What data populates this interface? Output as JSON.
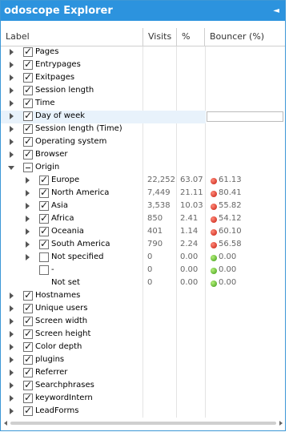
{
  "window": {
    "title": "odoscope Explorer",
    "close_glyph": "◄"
  },
  "columns": {
    "label": "Label",
    "visits": "Visits",
    "percent": "%",
    "bouncer": "Bouncer (%)"
  },
  "tree": [
    {
      "label": "Pages",
      "level": 0,
      "toggle": "closed",
      "checked": "on"
    },
    {
      "label": "Entrypages",
      "level": 0,
      "toggle": "closed",
      "checked": "on"
    },
    {
      "label": "Exitpages",
      "level": 0,
      "toggle": "closed",
      "checked": "on"
    },
    {
      "label": "Session length",
      "level": 0,
      "toggle": "closed",
      "checked": "on"
    },
    {
      "label": "Time",
      "level": 0,
      "toggle": "closed",
      "checked": "on"
    },
    {
      "label": "Day of week",
      "level": 0,
      "toggle": "closed",
      "checked": "on",
      "highlight": true
    },
    {
      "label": "Session length (Time)",
      "level": 0,
      "toggle": "closed",
      "checked": "on"
    },
    {
      "label": "Operating system",
      "level": 0,
      "toggle": "closed",
      "checked": "on"
    },
    {
      "label": "Browser",
      "level": 0,
      "toggle": "closed",
      "checked": "on"
    },
    {
      "label": "Origin",
      "level": 0,
      "toggle": "open",
      "checked": "partial"
    },
    {
      "label": "Europe",
      "level": 1,
      "toggle": "closed",
      "checked": "on",
      "visits": "22,252",
      "percent": "63.07",
      "bouncer": "61.13",
      "status": "red"
    },
    {
      "label": "North America",
      "level": 1,
      "toggle": "closed",
      "checked": "on",
      "visits": "7,449",
      "percent": "21.11",
      "bouncer": "80.41",
      "status": "red"
    },
    {
      "label": "Asia",
      "level": 1,
      "toggle": "closed",
      "checked": "on",
      "visits": "3,538",
      "percent": "10.03",
      "bouncer": "55.82",
      "status": "red"
    },
    {
      "label": "Africa",
      "level": 1,
      "toggle": "closed",
      "checked": "on",
      "visits": "850",
      "percent": "2.41",
      "bouncer": "54.12",
      "status": "red"
    },
    {
      "label": "Oceania",
      "level": 1,
      "toggle": "closed",
      "checked": "on",
      "visits": "401",
      "percent": "1.14",
      "bouncer": "60.10",
      "status": "red"
    },
    {
      "label": "South America",
      "level": 1,
      "toggle": "closed",
      "checked": "on",
      "visits": "790",
      "percent": "2.24",
      "bouncer": "56.58",
      "status": "red"
    },
    {
      "label": "Not specified",
      "level": 1,
      "toggle": "closed",
      "checked": "off",
      "visits": "0",
      "percent": "0.00",
      "bouncer": "0.00",
      "status": "green"
    },
    {
      "label": "-",
      "level": 1,
      "toggle": "none",
      "checked": "off",
      "visits": "0",
      "percent": "0.00",
      "bouncer": "0.00",
      "status": "green"
    },
    {
      "label": "Not set",
      "level": 1,
      "toggle": "none",
      "checked": "none",
      "visits": "0",
      "percent": "0.00",
      "bouncer": "0.00",
      "status": "green"
    },
    {
      "label": "Hostnames",
      "level": 0,
      "toggle": "closed",
      "checked": "on"
    },
    {
      "label": "Unique users",
      "level": 0,
      "toggle": "closed",
      "checked": "on"
    },
    {
      "label": "Screen width",
      "level": 0,
      "toggle": "closed",
      "checked": "on"
    },
    {
      "label": "Screen height",
      "level": 0,
      "toggle": "closed",
      "checked": "on"
    },
    {
      "label": "Color depth",
      "level": 0,
      "toggle": "closed",
      "checked": "on"
    },
    {
      "label": "plugins",
      "level": 0,
      "toggle": "closed",
      "checked": "on"
    },
    {
      "label": "Referrer",
      "level": 0,
      "toggle": "closed",
      "checked": "on"
    },
    {
      "label": "Searchphrases",
      "level": 0,
      "toggle": "closed",
      "checked": "on"
    },
    {
      "label": "keywordIntern",
      "level": 0,
      "toggle": "closed",
      "checked": "on"
    },
    {
      "label": "LeadForms",
      "level": 0,
      "toggle": "closed",
      "checked": "on"
    }
  ],
  "colors": {
    "title_bar": "#2c93de",
    "bounce_high": "#c61d10",
    "bounce_ok": "#3c9b15"
  }
}
